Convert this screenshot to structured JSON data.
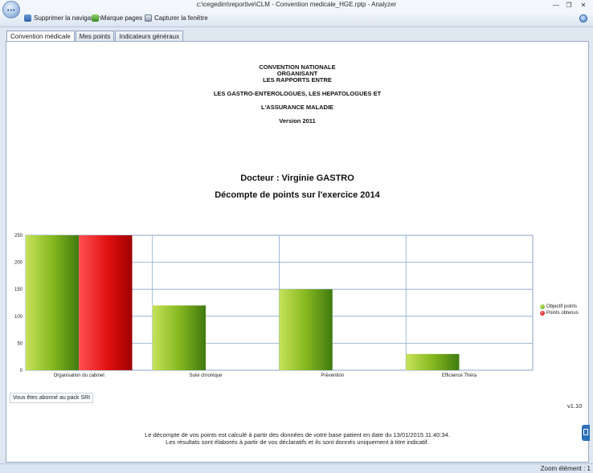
{
  "window": {
    "title": "c:\\cegedim\\reportive\\CLM - Convention medicale_HGE.rptp - Analyzer",
    "min_glyph": "—",
    "max_glyph": "❐",
    "close_glyph": "✕"
  },
  "toolbar": {
    "remove_nav_label": "Supprimer la navigation",
    "bookmarks_label": "Marque pages",
    "capture_label": "Capturer la fenêtre"
  },
  "tabs": [
    {
      "label": "Convention médicale",
      "active": true
    },
    {
      "label": "Mes points",
      "active": false
    },
    {
      "label": "Indicateurs généraux",
      "active": false
    }
  ],
  "report": {
    "header_lines": [
      "CONVENTION NATIONALE",
      "ORGANISANT",
      "LES RAPPORTS ENTRE",
      "LES GASTRO-ENTEROLOGUES, LES HEPATOLOGUES ET",
      "L'ASSURANCE MALADIE",
      "Version 2011"
    ],
    "doctor": "Docteur : Virginie GASTRO",
    "subtitle": "Décompte de points sur l'exercice 2014",
    "pack_text": "Vous êtes abonné au pack SRI",
    "version": "v1.10",
    "footnote_line1": "Le décompte de vos points est calculé à partir des données de votre base patient en date du 13/01/2015 11:40:34.",
    "footnote_line2": "Les résultats sont élaborés à partir de vos déclaratifs et ils sont donnés uniquement à titre indicatif."
  },
  "chart_data": {
    "type": "bar",
    "categories": [
      "Organisation du cabinet",
      "Suivi chronique",
      "Prévention",
      "Efficience Théra"
    ],
    "series": [
      {
        "name": "Objectif points",
        "values": [
          250,
          120,
          150,
          30
        ],
        "color": "#7fb51c"
      },
      {
        "name": "Points obtenus",
        "values": [
          250,
          0,
          0,
          0
        ],
        "color": "#e10f0f"
      }
    ],
    "ylim": [
      0,
      250
    ],
    "yticks": [
      0,
      50,
      100,
      150,
      200,
      250
    ],
    "grid": true,
    "legend": "right"
  },
  "status": {
    "zoom_text": "Zoom élément : 1"
  },
  "colors": {
    "objective": "#7fb51c",
    "obtained": "#e10f0f",
    "grid": "#8aa6c8"
  }
}
